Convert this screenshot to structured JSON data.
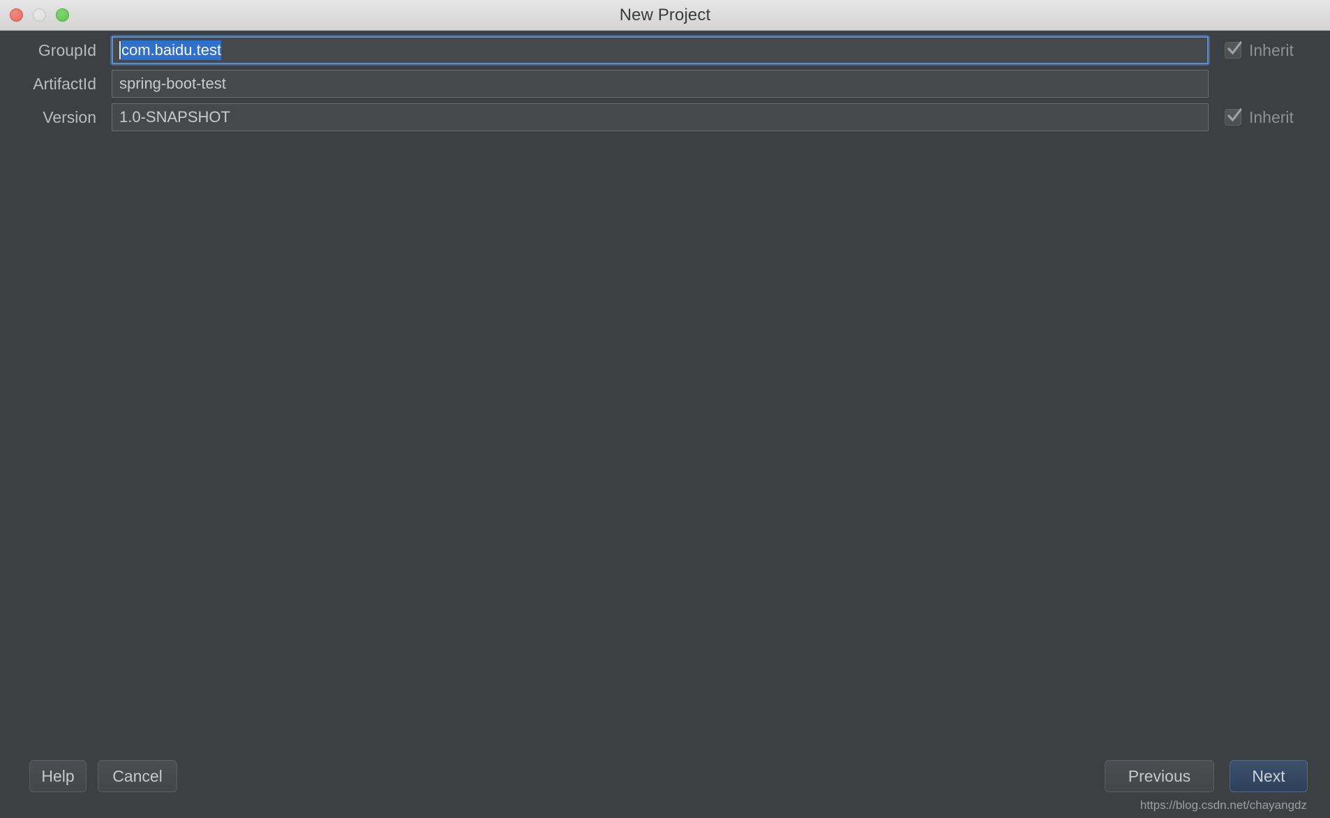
{
  "window": {
    "title": "New Project",
    "background_color": "#3c4043",
    "titlebar_color": "#dcdcdc"
  },
  "traffic_lights": {
    "close_color": "#ec6a5e",
    "minimize_color": "#dcdcdc",
    "zoom_color": "#5ec352"
  },
  "form": {
    "rows": [
      {
        "label": "GroupId",
        "value": "com.baidu.test",
        "focused": true,
        "selected": true,
        "inherit_label": "Inherit",
        "inherit_checked": true,
        "has_inherit": true
      },
      {
        "label": "ArtifactId",
        "value": "spring-boot-test",
        "focused": false,
        "selected": false,
        "inherit_label": "",
        "inherit_checked": false,
        "has_inherit": false
      },
      {
        "label": "Version",
        "value": "1.0-SNAPSHOT",
        "focused": false,
        "selected": false,
        "inherit_label": "Inherit",
        "inherit_checked": true,
        "has_inherit": true
      }
    ]
  },
  "footer": {
    "help_label": "Help",
    "cancel_label": "Cancel",
    "previous_label": "Previous",
    "next_label": "Next",
    "next_is_default": true
  },
  "watermark": {
    "text": "https://blog.csdn.net/chayangdz"
  },
  "colors": {
    "selection_blue": "#2f6fd0",
    "focus_border": "#5b8fd0",
    "default_button_blue": "#3a506e",
    "field_background": "#45494c",
    "label_text": "#b9bcbd"
  }
}
